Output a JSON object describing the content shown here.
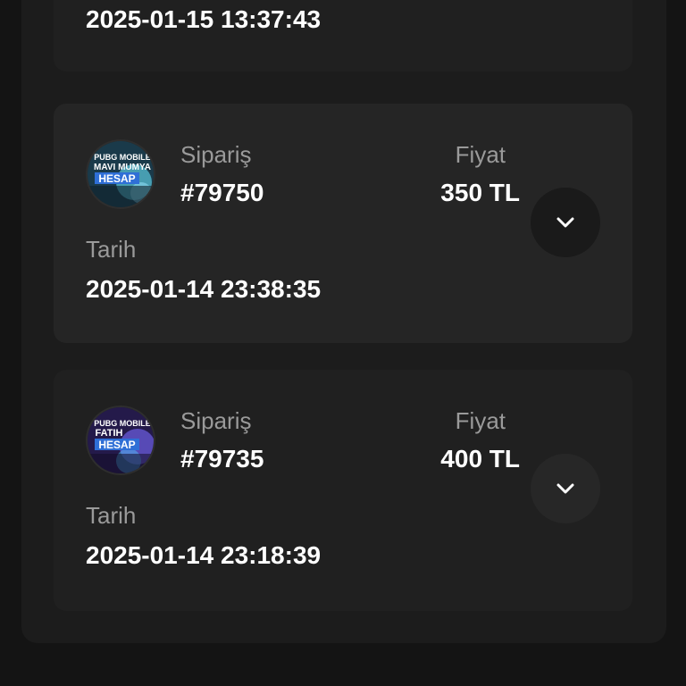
{
  "orders": [
    {
      "date_value": "2025-01-15 13:37:43"
    },
    {
      "order_label": "Sipariş",
      "order_number": "#79750",
      "price_label": "Fiyat",
      "price_value": "350 TL",
      "date_label": "Tarih",
      "date_value": "2025-01-14 23:38:35",
      "thumbnail_text": [
        "PUBG MOBILE",
        "MAVI MUMYA",
        "HESAP"
      ],
      "thumbnail_colors": {
        "bg": "#1a3a4a",
        "accent": "#5fd3e8",
        "banner": "#2f6fd6"
      },
      "toggle_icon": "chevron-down-icon"
    },
    {
      "order_label": "Sipariş",
      "order_number": "#79735",
      "price_label": "Fiyat",
      "price_value": "400 TL",
      "date_label": "Tarih",
      "date_value": "2025-01-14 23:18:39",
      "thumbnail_text": [
        "PUBG MOBILE",
        "FATIH",
        "HESAP"
      ],
      "thumbnail_colors": {
        "bg": "#241a4a",
        "accent": "#7a6bff",
        "banner": "#2f6fd6"
      },
      "toggle_icon": "chevron-down-icon"
    }
  ]
}
